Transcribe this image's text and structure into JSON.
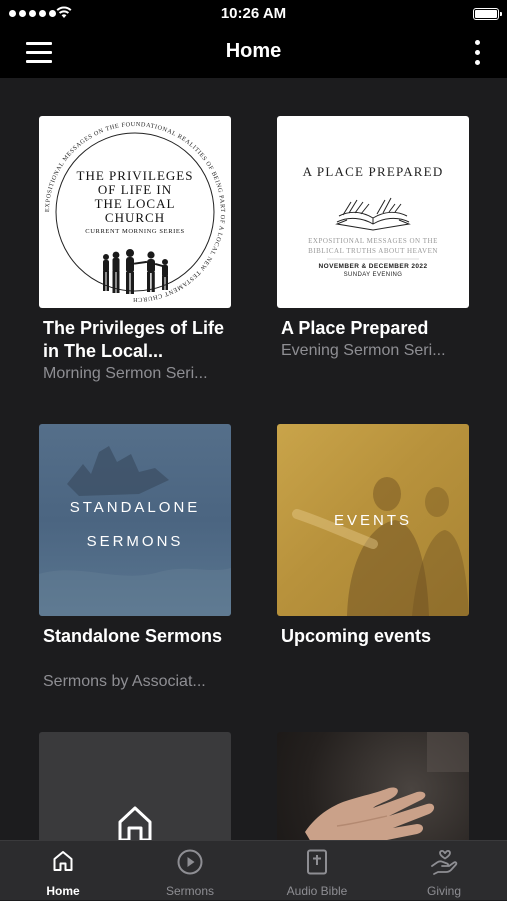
{
  "status_bar": {
    "time": "10:26 AM"
  },
  "header": {
    "title": "Home"
  },
  "cards": [
    {
      "title": "The Privileges of Life in The Local...",
      "subtitle": "Morning Sermon Seri...",
      "artwork": {
        "ring_text": "EXPOSITIONAL MESSAGES ON THE FOUNDATIONAL REALITIES OF BEING PART OF A LOCAL NEW TESTAMENT CHURCH",
        "line1": "THE PRIVILEGES",
        "line2": "OF LIFE IN",
        "line3": "THE LOCAL",
        "line4": "CHURCH",
        "tag": "CURRENT MORNING SERIES"
      }
    },
    {
      "title": "A Place Prepared",
      "subtitle": "Evening Sermon Seri...",
      "artwork": {
        "heading": "A PLACE PREPARED",
        "line1": "EXPOSITIONAL MESSAGES ON THE",
        "line2": "BIBLICAL TRUTHS ABOUT HEAVEN",
        "date": "NOVEMBER & DECEMBER 2022",
        "time": "SUNDAY EVENING"
      }
    },
    {
      "title": "Standalone Sermons",
      "subtitle": "Sermons by Associat...",
      "artwork": {
        "line1": "STANDALONE",
        "line2": "SERMONS"
      }
    },
    {
      "title": "Upcoming events",
      "subtitle": "",
      "artwork": {
        "label": "EVENTS"
      }
    }
  ],
  "tabs": [
    {
      "label": "Home",
      "icon": "home-icon",
      "active": true
    },
    {
      "label": "Sermons",
      "icon": "play-circle-icon",
      "active": false
    },
    {
      "label": "Audio Bible",
      "icon": "bible-icon",
      "active": false
    },
    {
      "label": "Giving",
      "icon": "giving-hand-icon",
      "active": false
    }
  ],
  "colors": {
    "background": "#1c1c1e",
    "tab_bar": "#2c2c2e",
    "subtitle": "#8e8e93",
    "events_tint": "#c9a44a",
    "standalone_tint": "#4f6a86"
  }
}
